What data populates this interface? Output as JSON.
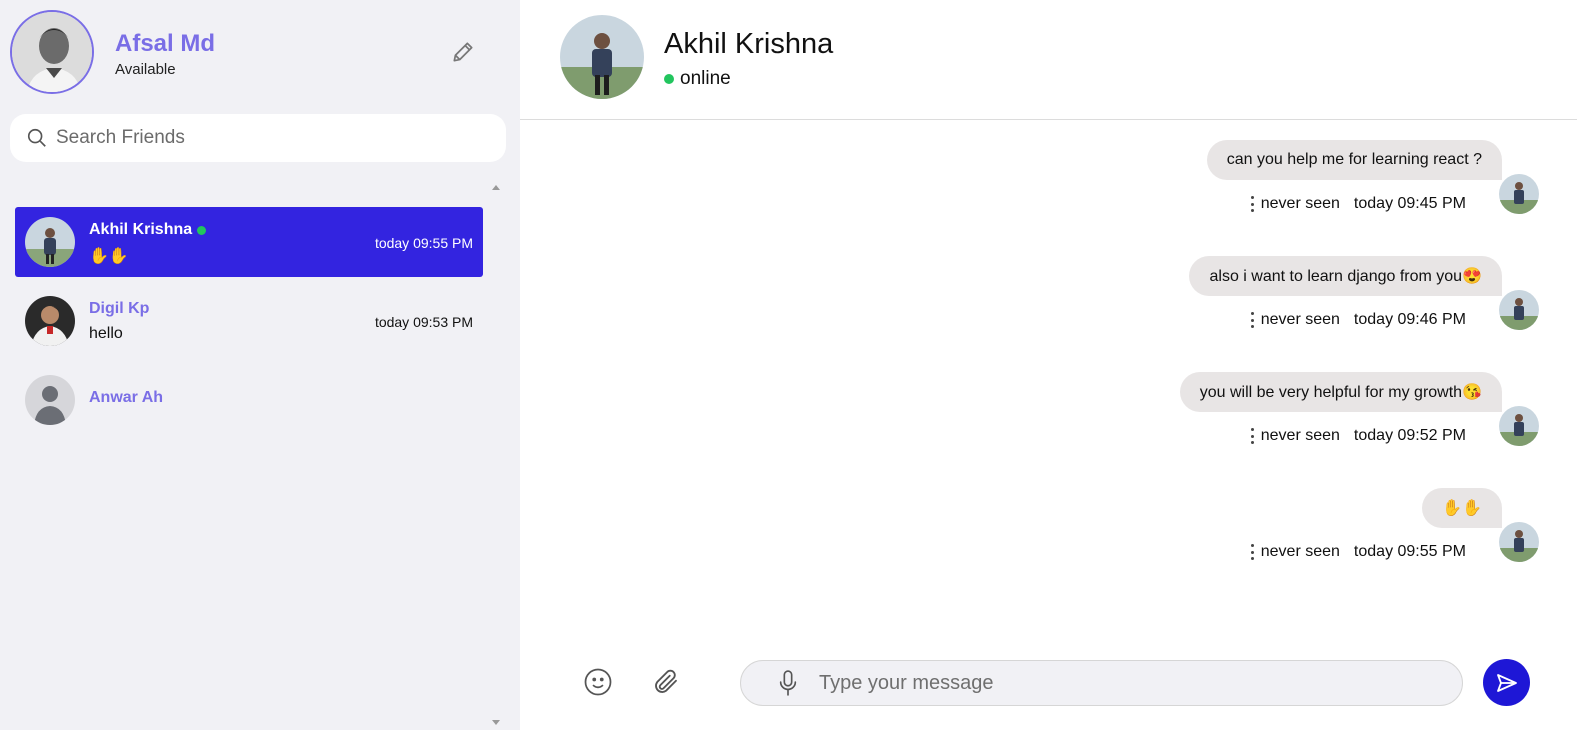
{
  "me": {
    "name": "Afsal Md",
    "status": "Available"
  },
  "search": {
    "placeholder": "Search Friends"
  },
  "contacts": [
    {
      "name": "Akhil Krishna",
      "online": true,
      "preview": "✋✋",
      "time": "today 09:55 PM",
      "active": true
    },
    {
      "name": "Digil Kp",
      "online": false,
      "preview": "hello",
      "time": "today 09:53 PM",
      "active": false
    },
    {
      "name": "Anwar Ah",
      "online": false,
      "preview": "",
      "time": "",
      "active": false
    }
  ],
  "chat": {
    "peer_name": "Akhil Krishna",
    "peer_status": "online",
    "messages": [
      {
        "text": "can you help me for learning react ?",
        "seen": "never seen",
        "time": "today 09:45 PM"
      },
      {
        "text": "also i want to learn django from you😍",
        "seen": "never seen",
        "time": "today 09:46 PM"
      },
      {
        "text": "you will be very helpful for my growth😘",
        "seen": "never seen",
        "time": "today 09:52 PM"
      },
      {
        "text": "✋✋",
        "seen": "never seen",
        "time": "today 09:55 PM"
      }
    ]
  },
  "composer": {
    "placeholder": "Type your message"
  },
  "colors": {
    "accent": "#7a6ee6",
    "active_row": "#3324e0",
    "send": "#1e17d6",
    "online": "#22c55e",
    "bubble": "#e8e5e5"
  }
}
